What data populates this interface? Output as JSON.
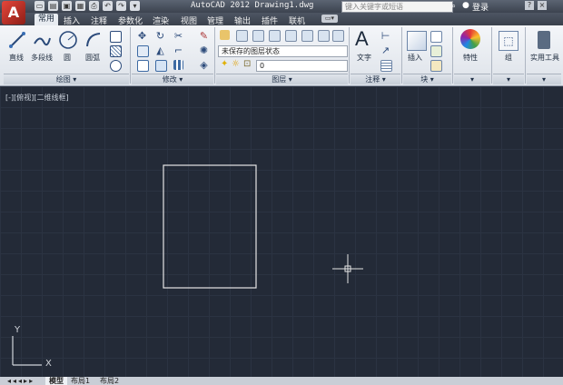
{
  "titlebar": {
    "app_logo": "A",
    "title": "AutoCAD 2012    Drawing1.dwg",
    "search_placeholder": "键入关键字或短语",
    "login_label": "登录"
  },
  "tabs": [
    {
      "label": "常用"
    },
    {
      "label": "插入"
    },
    {
      "label": "注释"
    },
    {
      "label": "参数化"
    },
    {
      "label": "渲染"
    },
    {
      "label": "视图"
    },
    {
      "label": "管理"
    },
    {
      "label": "输出"
    },
    {
      "label": "插件"
    },
    {
      "label": "联机"
    }
  ],
  "ribbon": {
    "draw": {
      "line": "直线",
      "polyline": "多段线",
      "circle": "圆",
      "arc": "圆弧",
      "footer": "绘图 ▾"
    },
    "modify": {
      "footer": "修改 ▾"
    },
    "layers": {
      "layer_state": "未保存的图层状态",
      "current_layer": "0",
      "footer": "图层 ▾"
    },
    "annotation": {
      "text": "文字",
      "footer": "注释 ▾"
    },
    "block": {
      "insert": "插入",
      "footer": "块 ▾"
    },
    "properties": {
      "label": "特性",
      "footer": "▾"
    },
    "groups": {
      "label": "组",
      "footer": "▾"
    },
    "utilities": {
      "label": "实用工具",
      "footer": "▾"
    }
  },
  "viewport": {
    "label": "[-][俯视][二维线框]",
    "ucs_y": "Y",
    "ucs_x": "X"
  },
  "layout_tabs": [
    {
      "label": "模型"
    },
    {
      "label": "布局1"
    },
    {
      "label": "布局2"
    }
  ],
  "colors": {
    "canvas_bg": "#232a37",
    "grid": "#2b3342",
    "drawing_line": "#e6e6e6",
    "logo_red": "#c0392b"
  }
}
